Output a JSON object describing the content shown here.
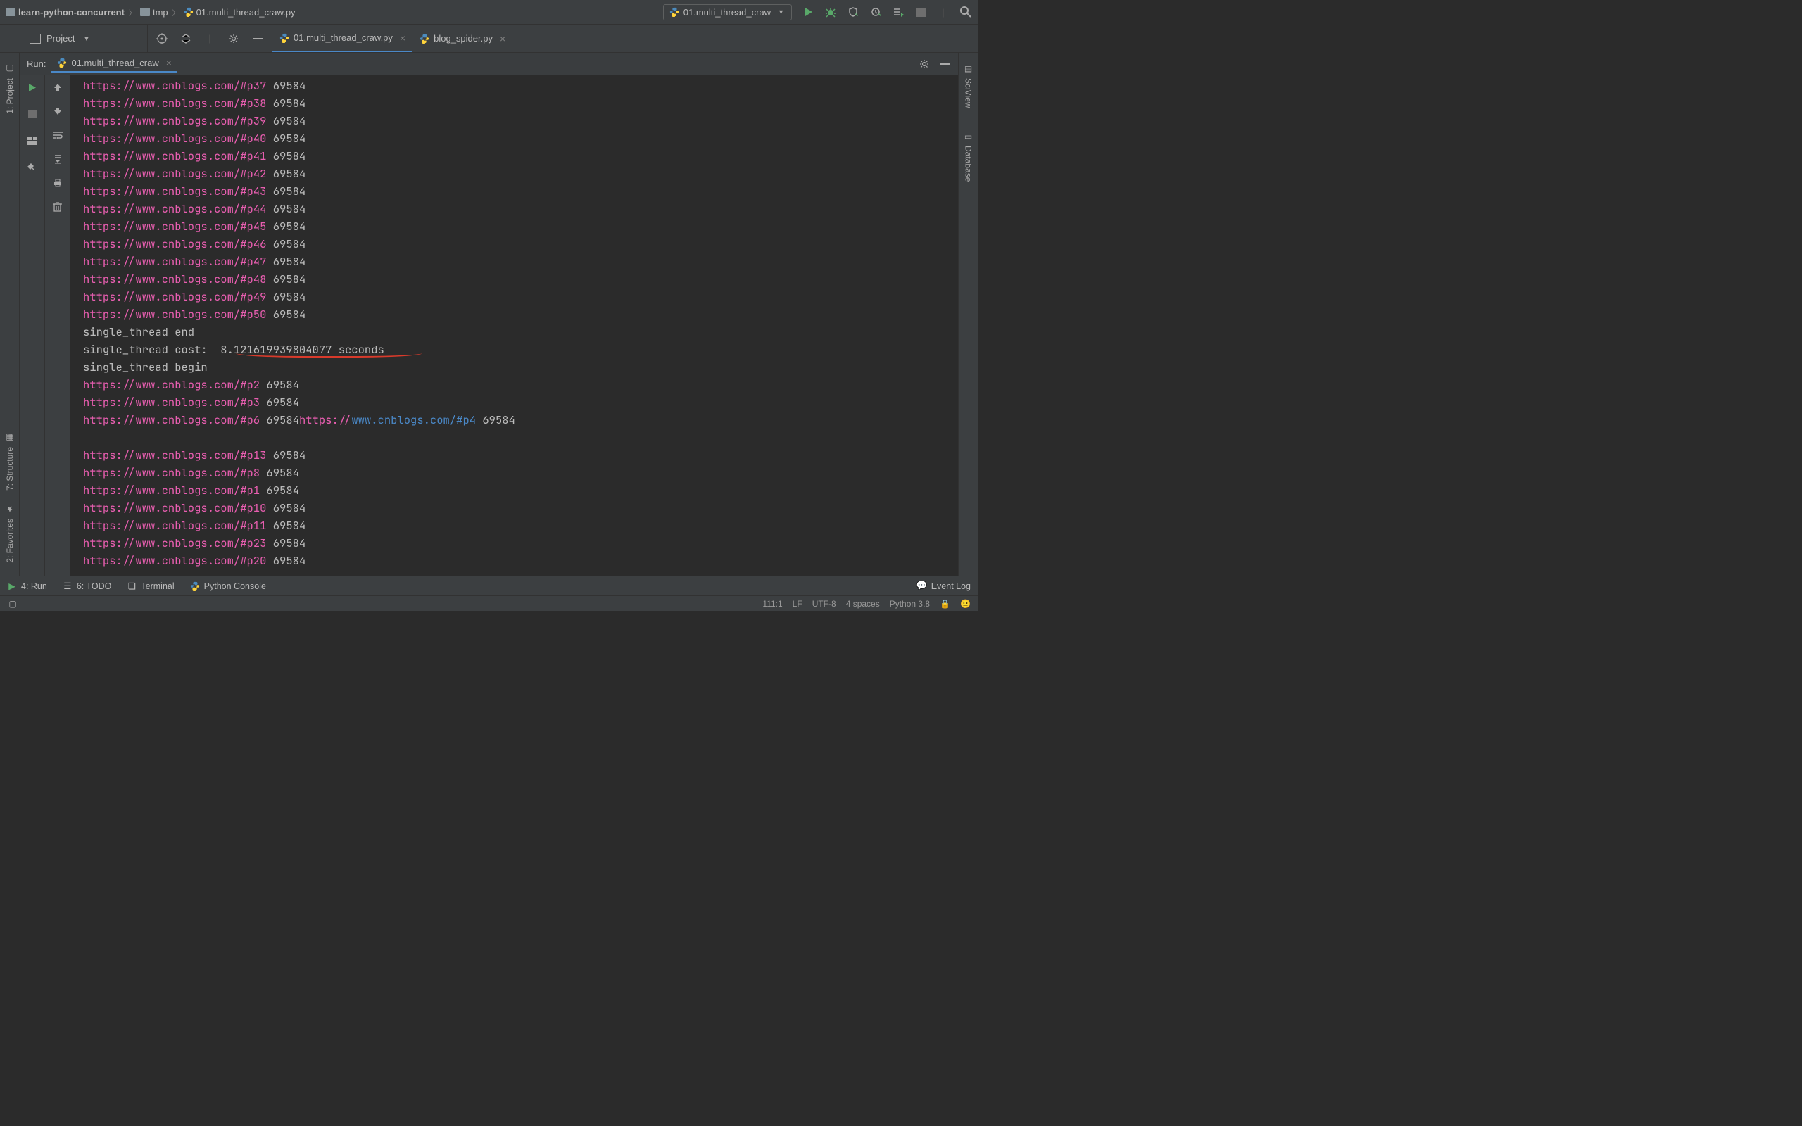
{
  "breadcrumb": {
    "project": "learn-python-concurrent",
    "folder": "tmp",
    "file": "01.multi_thread_craw.py"
  },
  "run_config": {
    "label": "01.multi_thread_craw"
  },
  "project_label": "Project",
  "editor_tabs": [
    {
      "label": "01.multi_thread_craw.py"
    },
    {
      "label": "blog_spider.py"
    }
  ],
  "run_panel": {
    "label": "Run:",
    "tab": "01.multi_thread_craw"
  },
  "left_rail": [
    "1: Project"
  ],
  "left_rail_lower": [
    "7: Structure",
    "2: Favorites"
  ],
  "right_rail": [
    "SciView",
    "Database"
  ],
  "console": {
    "url_base": "https://www.cnblogs.com/#p",
    "size": "69584",
    "first_block_pages": [
      37,
      38,
      39,
      40,
      41,
      42,
      43,
      44,
      45,
      46,
      47,
      48,
      49,
      50
    ],
    "end_line": "single_thread end",
    "cost_prefix": "single_thread cost:  ",
    "cost_value": "8.121619939804077 seconds",
    "begin_line": "single_thread begin",
    "second_urls_simple": [
      2,
      3
    ],
    "mixed_line_parts": {
      "p6": 6,
      "p4": 4
    },
    "third_block_pages": [
      13,
      8,
      1,
      10,
      11,
      23,
      20
    ]
  },
  "bottom_tabs": {
    "run": "4: Run",
    "todo": "6: TODO",
    "terminal": "Terminal",
    "py_console": "Python Console",
    "event_log": "Event Log"
  },
  "status": {
    "pos": "111:1",
    "le": "LF",
    "enc": "UTF-8",
    "indent": "4 spaces",
    "py": "Python 3.8"
  }
}
